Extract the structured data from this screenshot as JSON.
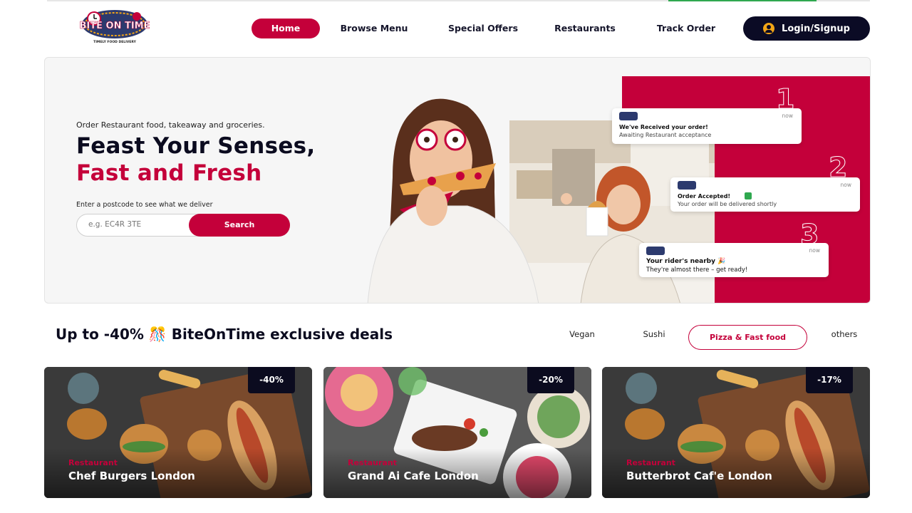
{
  "brand": {
    "logo_text": "BITE ON TIME",
    "tagline": "TIMELY FOOD DELIVERY",
    "accent": "#c4003a",
    "dark": "#0b0b25"
  },
  "nav": {
    "items": [
      "Home",
      "Browse Menu",
      "Special Offers",
      "Restaurants",
      "Track Order"
    ],
    "active": "Home",
    "login_label": "Login/Signup"
  },
  "hero": {
    "kicker": "Order Restaurant food, takeaway and groceries.",
    "title_line1": "Feast Your Senses,",
    "title_line2": "Fast and Fresh",
    "postcode_label": "Enter a postcode to see what we deliver",
    "postcode_placeholder": "e.g. EC4R 3TE",
    "search_label": "Search",
    "notifications": [
      {
        "step": "1",
        "title": "We've Received your order!",
        "body": "Awaiting Restaurant acceptance",
        "time": "now"
      },
      {
        "step": "2",
        "title": "Order Accepted!",
        "body": "Your order will be delivered shortly",
        "time": "now"
      },
      {
        "step": "3",
        "title": "Your rider's nearby 🎉",
        "body": "They're almost there – get ready!",
        "time": "now"
      }
    ]
  },
  "deals": {
    "title": "Up to -40% 🎊 BiteOnTime exclusive deals",
    "categories": [
      "Vegan",
      "Sushi",
      "Pizza & Fast food",
      "others"
    ],
    "active_category": "Pizza & Fast food",
    "cards": [
      {
        "discount": "-40%",
        "type": "Restaurant",
        "name": "Chef Burgers London"
      },
      {
        "discount": "-20%",
        "type": "Restaurant",
        "name": "Grand Ai Cafe London"
      },
      {
        "discount": "-17%",
        "type": "Restaurant",
        "name": "Butterbrot Caf'e London"
      }
    ]
  }
}
